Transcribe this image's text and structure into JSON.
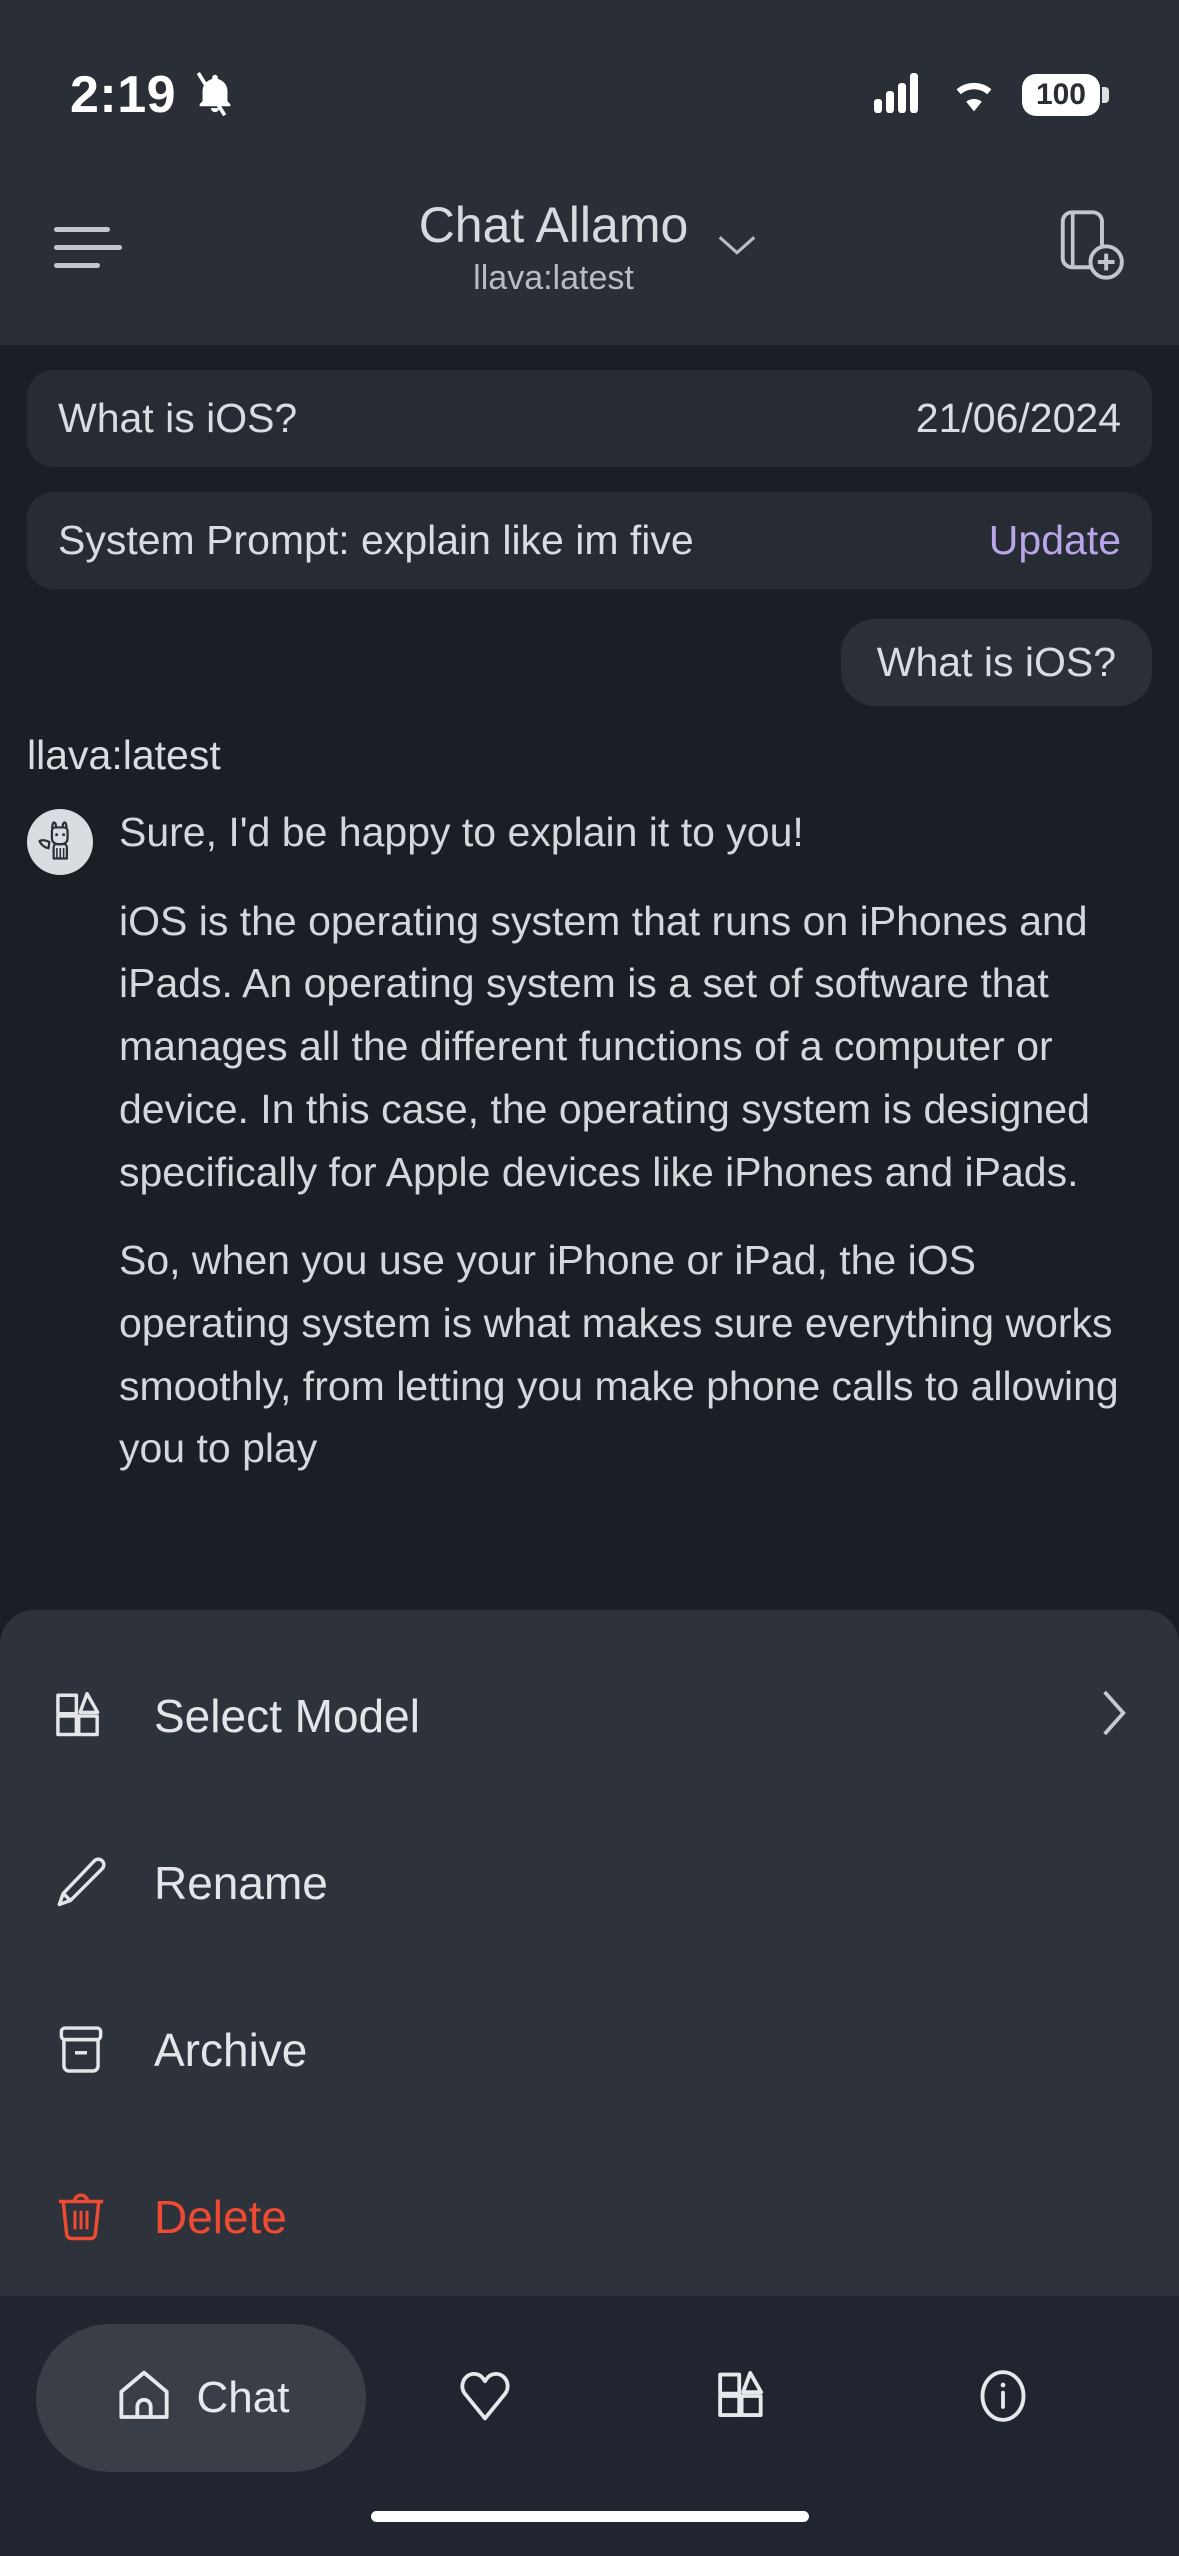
{
  "status_bar": {
    "time": "2:19",
    "silent_icon": "bell-slash-icon",
    "signal_icon": "cellular-signal-icon",
    "wifi_icon": "wifi-icon",
    "battery_level": "100"
  },
  "nav": {
    "menu_icon": "hamburger-menu-icon",
    "title": "Chat Allamo",
    "subtitle": "llava:latest",
    "chevron_icon": "chevron-down-icon",
    "new_chat_icon": "new-chat-icon"
  },
  "chat_info": {
    "title": "What is iOS?",
    "date": "21/06/2024"
  },
  "system_prompt": {
    "text": "System Prompt: explain like im five",
    "action_label": "Update"
  },
  "messages": {
    "user": "What is iOS?",
    "assistant_name": "llava:latest",
    "avatar_icon": "llama-avatar-icon",
    "assistant_paragraphs": [
      "Sure, I'd be happy to explain it to you!",
      "iOS is the operating system that runs on iPhones and iPads. An operating system is a set of software that manages all the different functions of a computer or device. In this case, the operating system is designed specifically for Apple devices like iPhones and iPads.",
      "So, when you use your iPhone or iPad, the iOS operating system is what makes sure everything works smoothly, from letting you make phone calls to allowing you to play"
    ]
  },
  "action_sheet": {
    "items": [
      {
        "label": "Select Model",
        "icon": "cube-box-icon",
        "accessory": "chevron-right-icon",
        "danger": false
      },
      {
        "label": "Rename",
        "icon": "pencil-icon",
        "accessory": "",
        "danger": false
      },
      {
        "label": "Archive",
        "icon": "archive-box-icon",
        "accessory": "",
        "danger": false
      },
      {
        "label": "Delete",
        "icon": "trash-icon",
        "accessory": "",
        "danger": true
      }
    ]
  },
  "tab_bar": {
    "tabs": [
      {
        "label": "Chat",
        "icon": "home-icon",
        "active": true
      },
      {
        "label": "",
        "icon": "heart-icon",
        "active": false
      },
      {
        "label": "",
        "icon": "cube-box-icon",
        "active": false
      },
      {
        "label": "",
        "icon": "info-circle-icon",
        "active": false
      }
    ]
  },
  "colors": {
    "background": "#1b1e24",
    "chrome": "#2a2e37",
    "sheet": "#2e323b",
    "accent": "#b9a6e8",
    "danger": "#ef4b32",
    "text": "#d9dce1"
  }
}
